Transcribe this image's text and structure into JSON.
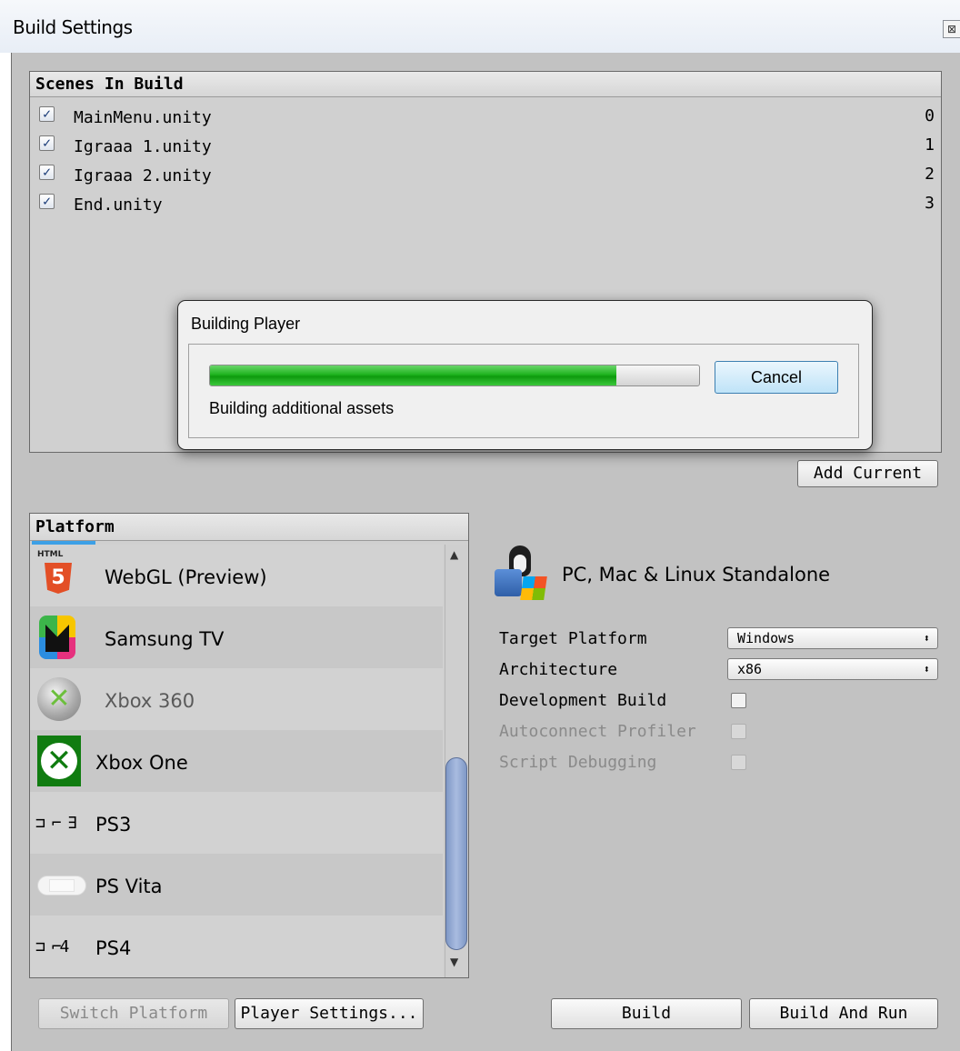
{
  "window": {
    "title": "Build Settings",
    "close_glyph": "⊠"
  },
  "scenes": {
    "header": "Scenes In Build",
    "items": [
      {
        "name": "MainMenu.unity",
        "index": "0",
        "checked": true
      },
      {
        "name": "Igraaa 1.unity",
        "index": "1",
        "checked": true
      },
      {
        "name": "Igraaa 2.unity",
        "index": "2",
        "checked": true
      },
      {
        "name": "End.unity",
        "index": "3",
        "checked": true
      }
    ],
    "add_current_label": "Add Current"
  },
  "dialog": {
    "title": "Building Player",
    "progress_fraction": 0.83,
    "status": "Building additional assets",
    "cancel_label": "Cancel",
    "progress_color": "#1fb41f"
  },
  "platform": {
    "header": "Platform",
    "items": [
      {
        "label": "WebGL (Preview)",
        "icon": "html5-icon",
        "icon_badge": "HTML",
        "icon_text": "5",
        "dimmed": false
      },
      {
        "label": "Samsung TV",
        "icon": "samsung-tv-icon",
        "dimmed": false
      },
      {
        "label": "Xbox 360",
        "icon": "xbox360-icon",
        "dimmed": true
      },
      {
        "label": "Xbox One",
        "icon": "xbox-one-icon",
        "dimmed": false
      },
      {
        "label": "PS3",
        "icon": "ps3-icon",
        "icon_text": "⊐ ⌐ ∃",
        "dimmed": false
      },
      {
        "label": "PS Vita",
        "icon": "ps-vita-icon",
        "dimmed": false
      },
      {
        "label": "PS4",
        "icon": "ps4-icon",
        "icon_text": "⊐ ⌐4",
        "dimmed": false
      }
    ]
  },
  "selected_platform": {
    "title": "PC, Mac & Linux Standalone",
    "icon": "pc-mac-linux-icon",
    "settings": {
      "target_platform_label": "Target Platform",
      "target_platform_value": "Windows",
      "architecture_label": "Architecture",
      "architecture_value": "x86",
      "development_build_label": "Development Build",
      "autoconnect_profiler_label": "Autoconnect Profiler",
      "script_debugging_label": "Script Debugging"
    }
  },
  "footer": {
    "switch_platform_label": "Switch Platform",
    "player_settings_label": "Player Settings...",
    "build_label": "Build",
    "build_and_run_label": "Build And Run"
  }
}
